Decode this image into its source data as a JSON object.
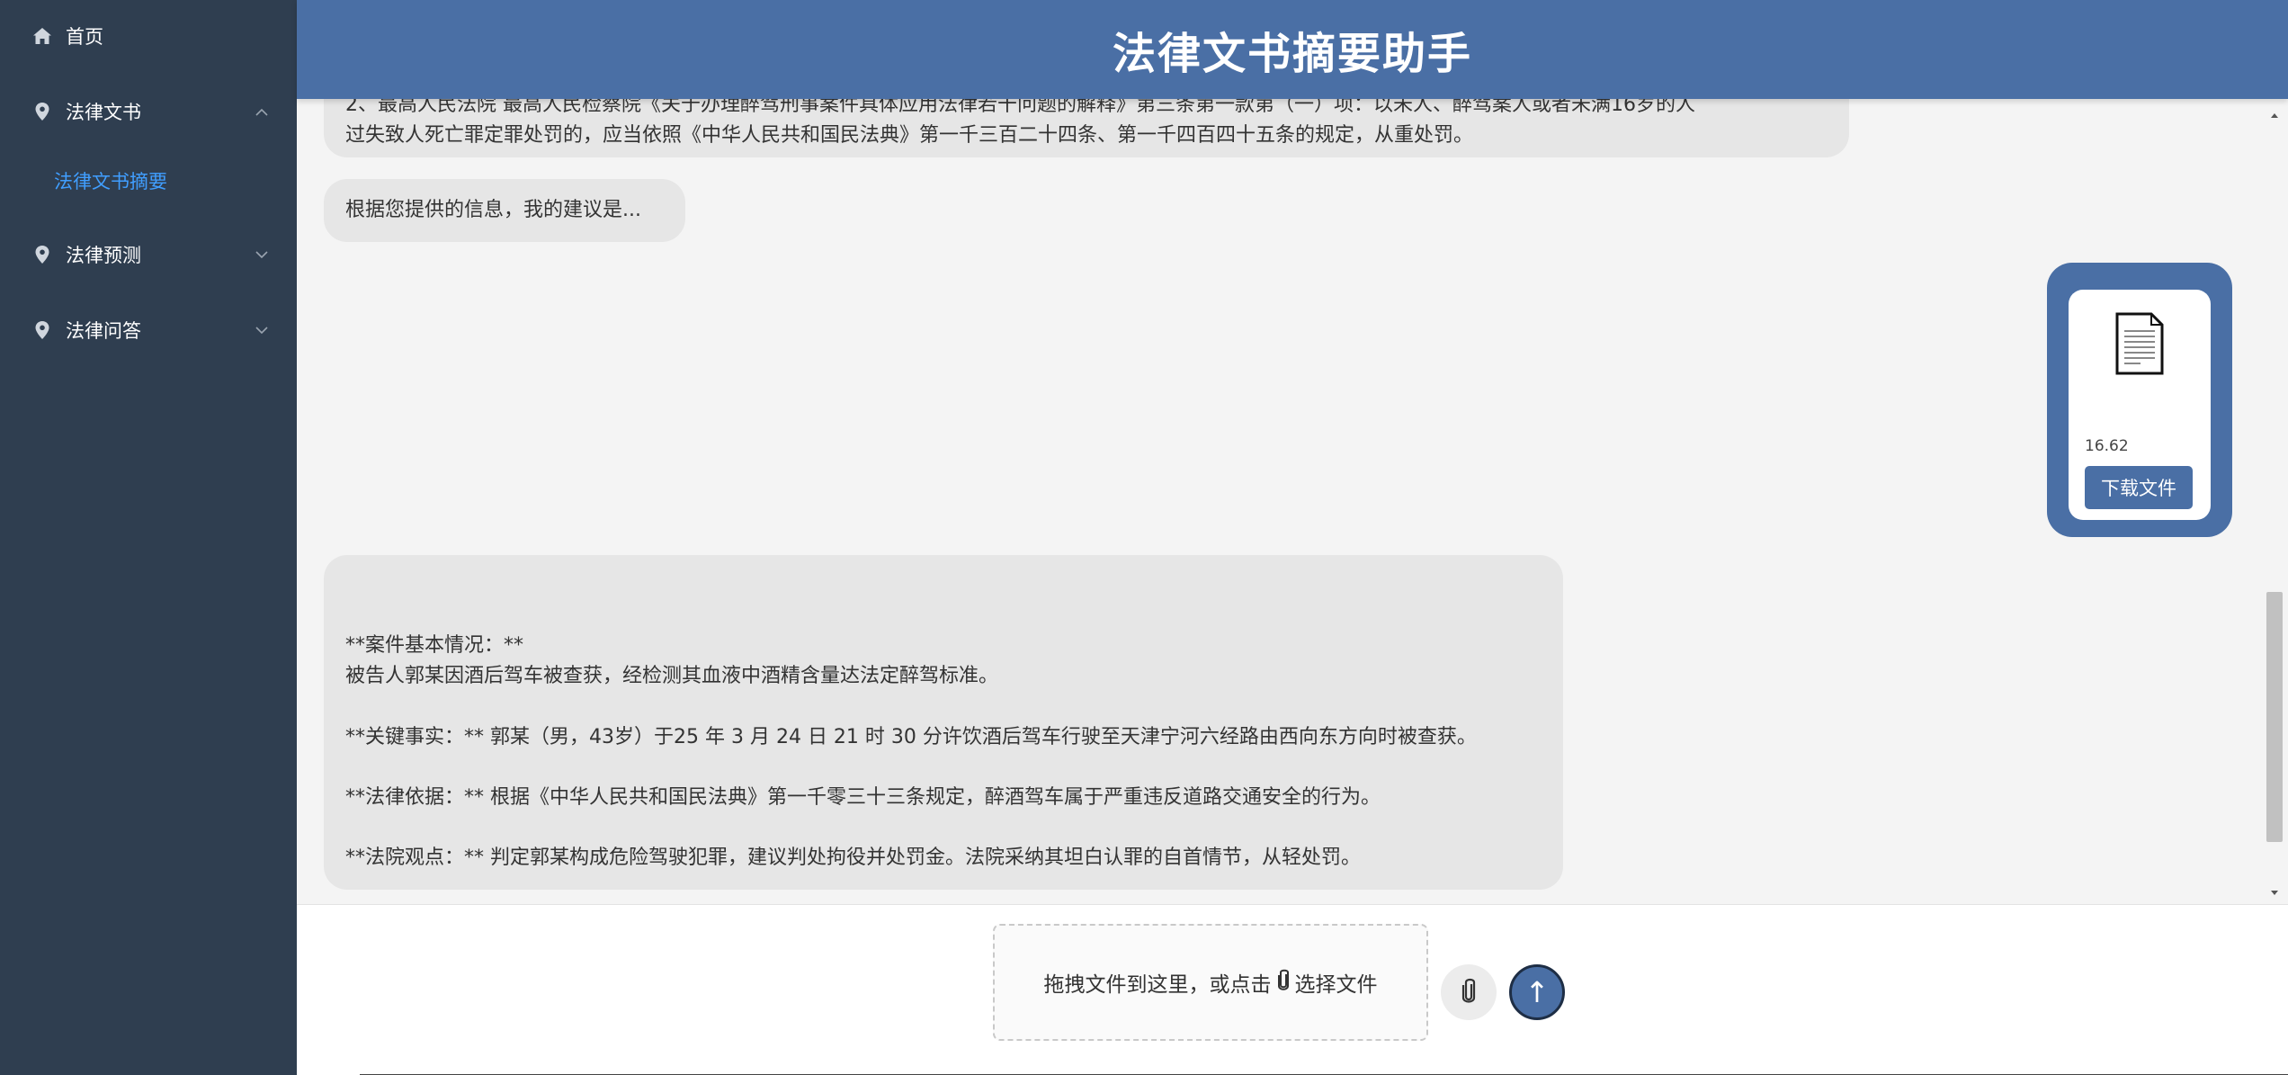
{
  "app": {
    "title": "法律文书摘要助手"
  },
  "sidebar": {
    "items": [
      {
        "label": "首页",
        "icon": "home-icon"
      },
      {
        "label": "法律文书",
        "icon": "location-icon",
        "expanded": true,
        "children": [
          {
            "label": "法律文书摘要",
            "active": true
          }
        ]
      },
      {
        "label": "法律预测",
        "icon": "location-icon",
        "expanded": false
      },
      {
        "label": "法律问答",
        "icon": "location-icon",
        "expanded": false
      }
    ]
  },
  "messages": {
    "legal_basis_partial": {
      "line1": "2、最高人民法院 最高人民检察院《关于办理醉驾刑事案件具体应用法律若干问题的解释》第三条第一款第（一）项：以未人、醉驾案人或者未满16岁的人",
      "line2": "过失致人死亡罪定罪处罚的，应当依照《中华人民共和国民法典》第一千三百二十四条、第一千四百四十五条的规定，从重处罚。"
    },
    "suggestion": "根据您提供的信息，我的建议是...",
    "file": {
      "size": "16.62",
      "download_label": "下载文件",
      "icon": "document-icon"
    },
    "summary": {
      "case_heading": "**案件基本情况：**",
      "case_text": "被告人郭某因酒后驾车被查获，经检测其血液中酒精含量达法定醉驾标准。",
      "facts": "**关键事实：** 郭某（男，43岁）于25 年 3 月 24 日 21 时 30 分许饮酒后驾车行驶至天津宁河六经路由西向东方向时被查获。",
      "basis": "**法律依据：** 根据《中华人民共和国民法典》第一千零三十三条规定，醉酒驾车属于严重违反道路交通安全的行为。",
      "opinion": "**法院观点：** 判定郭某构成危险驾驶犯罪，建议判处拘役并处罚金。法院采纳其坦白认罪的自首情节，从轻处罚。"
    }
  },
  "input": {
    "dropzone_text_before": "拖拽文件到这里，或点击",
    "dropzone_text_after": "选择文件",
    "send_label": "↑"
  },
  "colors": {
    "sidebar": "#2f3e50",
    "header": "#4a6fa5",
    "active_link": "#409eff",
    "bubble": "#e6e6e6"
  }
}
